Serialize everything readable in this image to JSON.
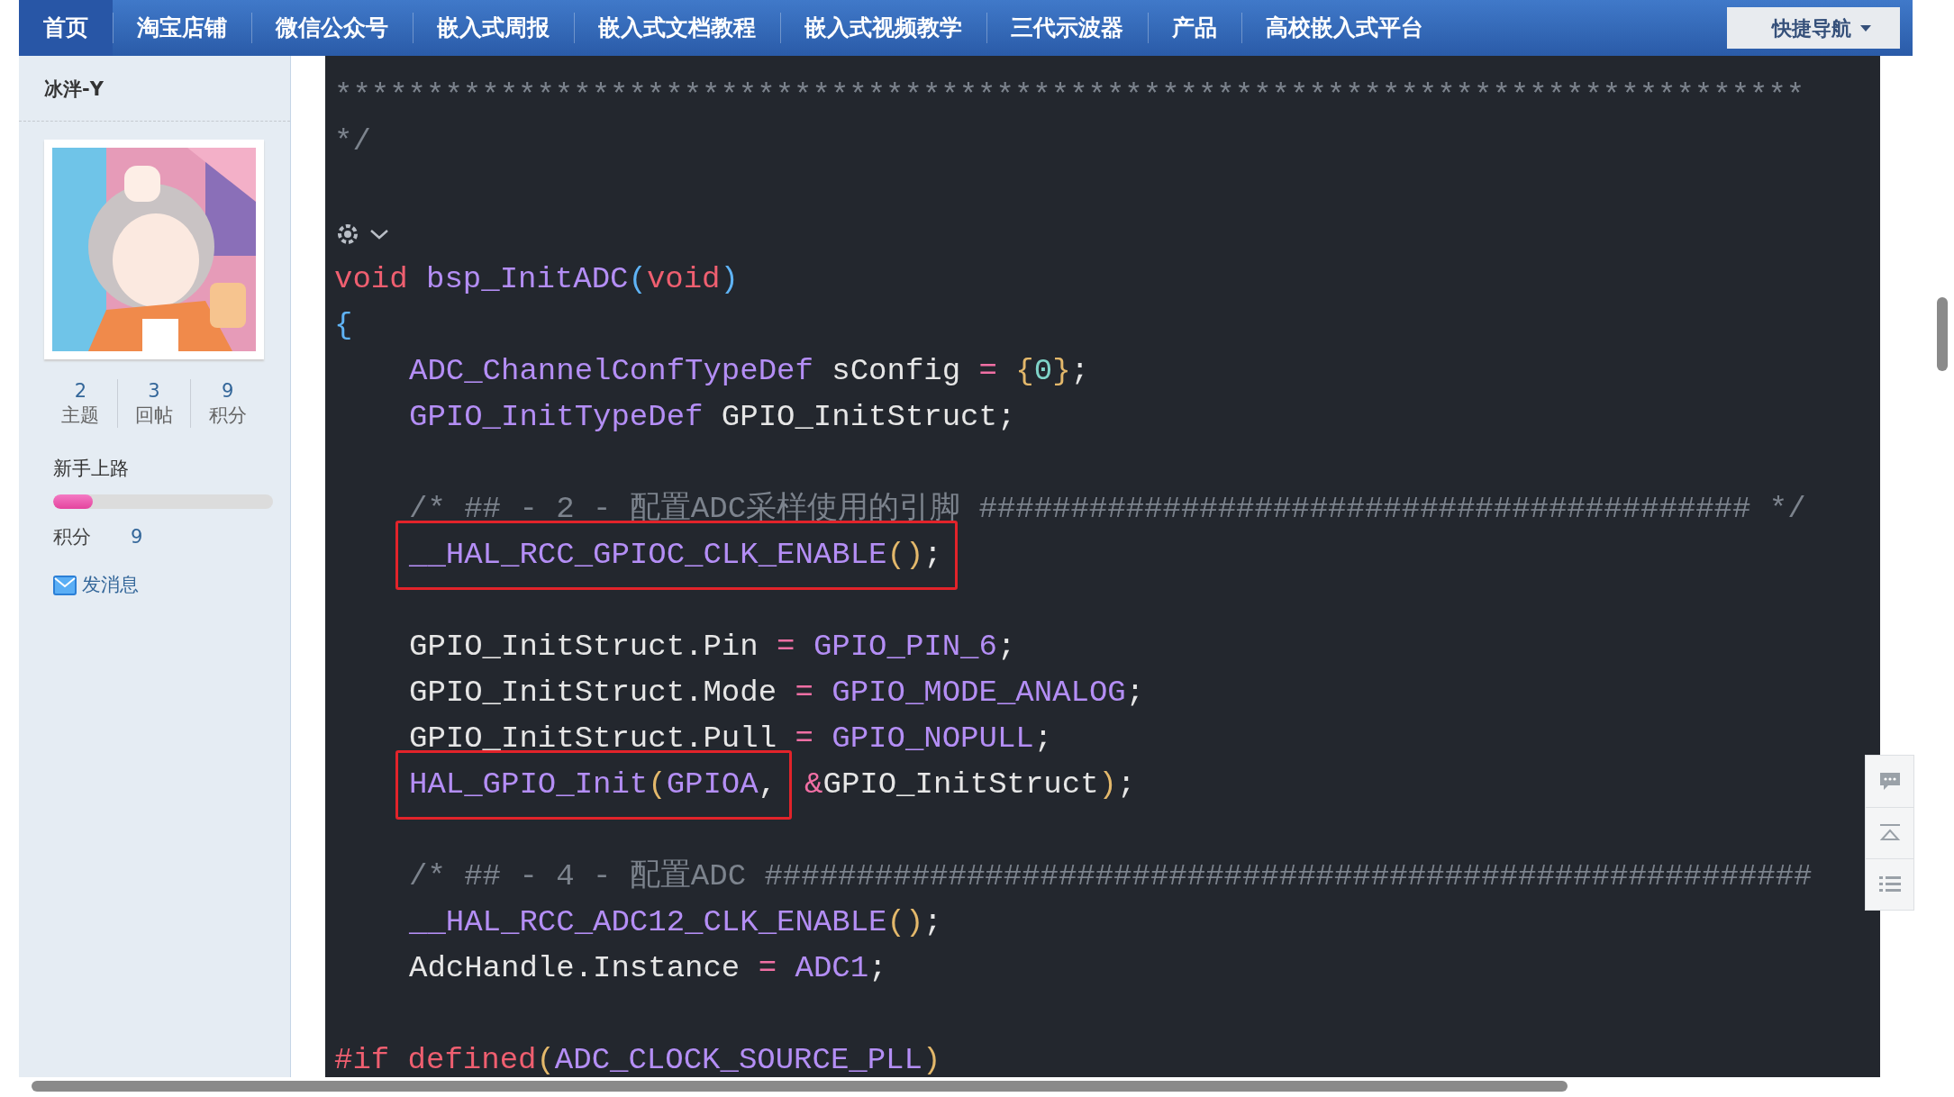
{
  "nav": {
    "items": [
      {
        "label": "首页",
        "selected": true
      },
      {
        "label": "淘宝店铺",
        "selected": false
      },
      {
        "label": "微信公众号",
        "selected": false
      },
      {
        "label": "嵌入式周报",
        "selected": false
      },
      {
        "label": "嵌入式文档教程",
        "selected": false
      },
      {
        "label": "嵌入式视频教学",
        "selected": false
      },
      {
        "label": "三代示波器",
        "selected": false
      },
      {
        "label": "产品",
        "selected": false
      },
      {
        "label": "高校嵌入式平台",
        "selected": false
      }
    ],
    "quick_nav": "快捷导航"
  },
  "profile": {
    "username": "冰泮-Y",
    "stats": [
      {
        "value": "2",
        "label": "主题"
      },
      {
        "value": "3",
        "label": "回帖"
      },
      {
        "value": "9",
        "label": "积分"
      }
    ],
    "rank": {
      "title": "新手上路",
      "level": 0.18
    },
    "points": {
      "label": "积分",
      "value": "9"
    },
    "message_link": "发消息"
  },
  "code": {
    "lines": [
      {
        "kind": "code",
        "indented": false,
        "segments": [
          {
            "boxed": false,
            "tokens": [
              {
                "kind": "comment",
                "text": "********************************************************************************"
              }
            ]
          }
        ]
      },
      {
        "kind": "code",
        "indented": false,
        "segments": [
          {
            "boxed": false,
            "tokens": [
              {
                "kind": "comment",
                "text": "*/"
              }
            ]
          }
        ]
      },
      {
        "kind": "blank"
      },
      {
        "kind": "icon"
      },
      {
        "kind": "code",
        "indented": false,
        "segments": [
          {
            "boxed": false,
            "tokens": [
              {
                "kind": "keyword",
                "text": "void "
              },
              {
                "kind": "function",
                "text": "bsp_InitADC"
              },
              {
                "kind": "bracket",
                "text": "("
              },
              {
                "kind": "keyword",
                "text": "void"
              },
              {
                "kind": "bracket",
                "text": ")"
              }
            ]
          }
        ]
      },
      {
        "kind": "code",
        "indented": false,
        "segments": [
          {
            "boxed": false,
            "tokens": [
              {
                "kind": "bracket",
                "text": "{"
              }
            ]
          }
        ]
      },
      {
        "kind": "code",
        "indented": true,
        "segments": [
          {
            "boxed": false,
            "tokens": [
              {
                "kind": "function",
                "text": "ADC_ChannelConfTypeDef"
              },
              {
                "kind": "plain",
                "text": " sConfig "
              },
              {
                "kind": "operator",
                "text": "= "
              },
              {
                "kind": "paren",
                "text": "{"
              },
              {
                "kind": "number",
                "text": "0"
              },
              {
                "kind": "paren",
                "text": "}"
              },
              {
                "kind": "plain",
                "text": ";"
              }
            ]
          }
        ]
      },
      {
        "kind": "code",
        "indented": true,
        "segments": [
          {
            "boxed": false,
            "tokens": [
              {
                "kind": "function",
                "text": "GPIO_InitTypeDef"
              },
              {
                "kind": "plain",
                "text": " GPIO_InitStruct;"
              }
            ]
          }
        ]
      },
      {
        "kind": "blank"
      },
      {
        "kind": "code",
        "indented": true,
        "segments": [
          {
            "boxed": false,
            "tokens": [
              {
                "kind": "comment",
                "text": "/* ## - 2 - 配置ADC采样使用的引脚 ########################################## */"
              }
            ]
          }
        ]
      },
      {
        "kind": "code",
        "indented": true,
        "segments": [
          {
            "boxed": true,
            "tokens": [
              {
                "kind": "function",
                "text": "__HAL_RCC_GPIOC_CLK_ENABLE"
              },
              {
                "kind": "paren",
                "text": "()"
              },
              {
                "kind": "plain",
                "text": ";"
              }
            ]
          }
        ]
      },
      {
        "kind": "blank"
      },
      {
        "kind": "code",
        "indented": true,
        "segments": [
          {
            "boxed": false,
            "tokens": [
              {
                "kind": "plain",
                "text": "GPIO_InitStruct.Pin "
              },
              {
                "kind": "operator",
                "text": "= "
              },
              {
                "kind": "function",
                "text": "GPIO_PIN_6"
              },
              {
                "kind": "plain",
                "text": ";"
              }
            ]
          }
        ]
      },
      {
        "kind": "code",
        "indented": true,
        "segments": [
          {
            "boxed": false,
            "tokens": [
              {
                "kind": "plain",
                "text": "GPIO_InitStruct.Mode "
              },
              {
                "kind": "operator",
                "text": "= "
              },
              {
                "kind": "function",
                "text": "GPIO_MODE_ANALOG"
              },
              {
                "kind": "plain",
                "text": ";"
              }
            ]
          }
        ]
      },
      {
        "kind": "code",
        "indented": true,
        "segments": [
          {
            "boxed": false,
            "tokens": [
              {
                "kind": "plain",
                "text": "GPIO_InitStruct.Pull "
              },
              {
                "kind": "operator",
                "text": "= "
              },
              {
                "kind": "function",
                "text": "GPIO_NOPULL"
              },
              {
                "kind": "plain",
                "text": ";"
              }
            ]
          }
        ]
      },
      {
        "kind": "code",
        "indented": true,
        "segments": [
          {
            "boxed": true,
            "tokens": [
              {
                "kind": "function",
                "text": "HAL_GPIO_Init"
              },
              {
                "kind": "paren",
                "text": "("
              },
              {
                "kind": "function",
                "text": "GPIOA"
              },
              {
                "kind": "plain",
                "text": ","
              }
            ]
          },
          {
            "boxed": false,
            "tokens": [
              {
                "kind": "operator",
                "text": "&"
              },
              {
                "kind": "plain",
                "text": "GPIO_InitStruct"
              },
              {
                "kind": "paren",
                "text": ")"
              },
              {
                "kind": "plain",
                "text": ";"
              }
            ]
          }
        ]
      },
      {
        "kind": "blank"
      },
      {
        "kind": "code",
        "indented": true,
        "segments": [
          {
            "boxed": false,
            "tokens": [
              {
                "kind": "comment",
                "text": "/* ## - 4 - 配置ADC #########################################################"
              }
            ]
          }
        ]
      },
      {
        "kind": "code",
        "indented": true,
        "segments": [
          {
            "boxed": false,
            "tokens": [
              {
                "kind": "function",
                "text": "__HAL_RCC_ADC12_CLK_ENABLE"
              },
              {
                "kind": "paren",
                "text": "()"
              },
              {
                "kind": "plain",
                "text": ";"
              }
            ]
          }
        ]
      },
      {
        "kind": "code",
        "indented": true,
        "segments": [
          {
            "boxed": false,
            "tokens": [
              {
                "kind": "plain",
                "text": "AdcHandle.Instance "
              },
              {
                "kind": "operator",
                "text": "= "
              },
              {
                "kind": "function",
                "text": "ADC1"
              },
              {
                "kind": "plain",
                "text": ";"
              }
            ]
          }
        ]
      },
      {
        "kind": "blank"
      },
      {
        "kind": "code",
        "indented": false,
        "segments": [
          {
            "boxed": false,
            "tokens": [
              {
                "kind": "keyword",
                "text": "#if defined"
              },
              {
                "kind": "paren",
                "text": "("
              },
              {
                "kind": "function",
                "text": "ADC_CLOCK_SOURCE_PLL"
              },
              {
                "kind": "paren",
                "text": ")"
              }
            ]
          }
        ]
      }
    ]
  }
}
